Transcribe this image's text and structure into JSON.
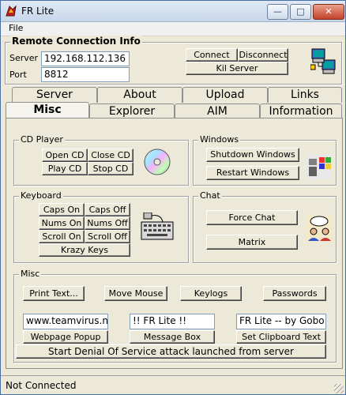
{
  "window": {
    "title": "FR Lite",
    "minimize": "—",
    "maximize": "□",
    "close": "✕"
  },
  "menu": {
    "file": "File"
  },
  "remote": {
    "group_label": "Remote Connection Info",
    "server_label": "Server",
    "server_value": "192.168.112.136",
    "port_label": "Port",
    "port_value": "8812",
    "connect": "Connect",
    "disconnect": "Disconnect",
    "kill_server": "Kil Server"
  },
  "tabs_row1": [
    "Server",
    "About",
    "Upload",
    "Links"
  ],
  "tabs_row2": [
    "Misc",
    "Explorer",
    "AIM",
    "Information"
  ],
  "cd_player": {
    "label": "CD Player",
    "open_cd": "Open CD",
    "close_cd": "Close CD",
    "play_cd": "Play CD",
    "stop_cd": "Stop CD"
  },
  "windows": {
    "label": "Windows",
    "shutdown": "Shutdown Windows",
    "restart": "Restart Windows"
  },
  "keyboard": {
    "label": "Keyboard",
    "caps_on": "Caps On",
    "caps_off": "Caps Off",
    "nums_on": "Nums On",
    "nums_off": "Nums Off",
    "scroll_on": "Scroll On",
    "scroll_off": "Scroll Off",
    "krazy_keys": "Krazy Keys"
  },
  "chat": {
    "label": "Chat",
    "force_chat": "Force Chat",
    "matrix": "Matrix"
  },
  "misc": {
    "label": "Misc",
    "print_text": "Print Text...",
    "move_mouse": "Move Mouse",
    "keylogs": "Keylogs",
    "passwords": "Passwords",
    "webpage_value": "www.teamvirus.net",
    "message_value": "!! FR Lite !!",
    "clipboard_value": "FR Lite -- by Gobo",
    "webpage_popup": "Webpage Popup",
    "message_box": "Message Box",
    "set_clipboard": "Set Clipboard Text",
    "dos": "Start Denial Of Service attack launched from server"
  },
  "status": {
    "text": "Not Connected"
  }
}
